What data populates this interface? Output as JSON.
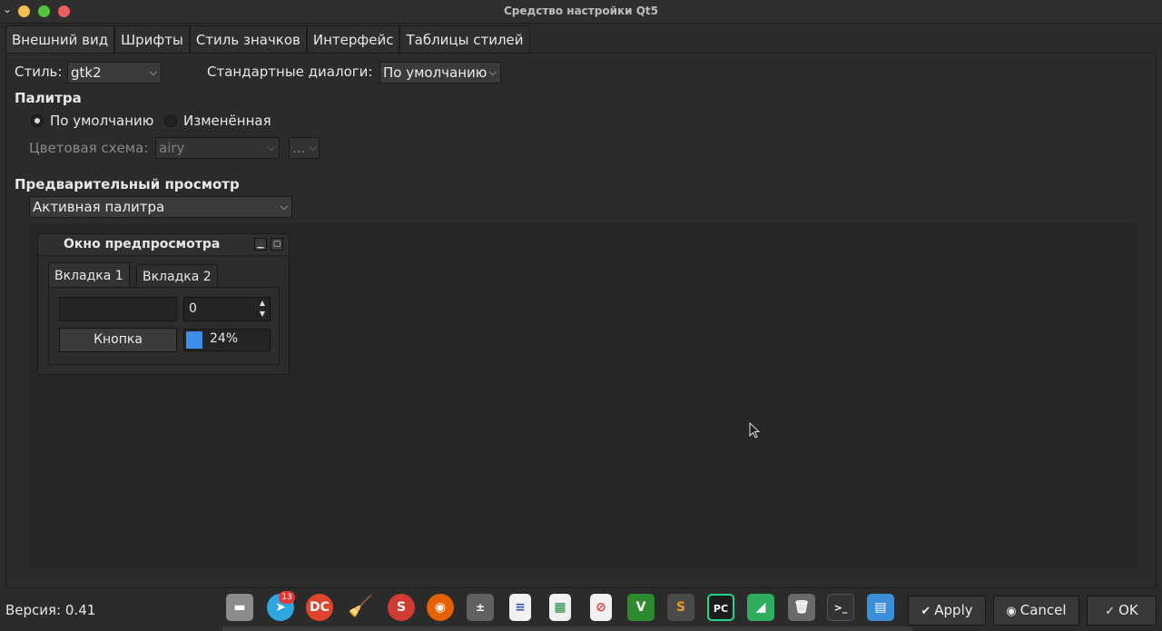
{
  "window": {
    "title": "Средство настройки Qt5"
  },
  "tabs": [
    {
      "label": "Внешний вид"
    },
    {
      "label": "Шрифты"
    },
    {
      "label": "Стиль значков"
    },
    {
      "label": "Интерфейс"
    },
    {
      "label": "Таблицы стилей"
    }
  ],
  "appearance": {
    "style_label": "Стиль:",
    "style_value": "gtk2",
    "dialogs_label": "Стандартные диалоги:",
    "dialogs_value": "По умолчанию",
    "palette_heading": "Палитра",
    "palette_default": "По умолчанию",
    "palette_custom": "Изменённая",
    "scheme_label": "Цветовая схема:",
    "scheme_value": "airy",
    "scheme_more": "...",
    "preview_heading": "Предварительный просмотр",
    "preview_combo": "Активная палитра"
  },
  "preview": {
    "window_title": "Окно предпросмотра",
    "tab1": "Вкладка 1",
    "tab2": "Вкладка 2",
    "spin_value": "0",
    "button_label": "Кнопка",
    "progress_text": "24%",
    "progress_value": 0.24
  },
  "footer": {
    "version": "Версия: 0.41",
    "apply": "Apply",
    "cancel": "Cancel",
    "ok": "OK"
  },
  "dock": {
    "telegram_badge": "13",
    "items": [
      {
        "name": "files-icon",
        "color": "#9e9e9e"
      },
      {
        "name": "telegram-icon",
        "color": "#2ea6e0"
      },
      {
        "name": "doublecmd-icon",
        "color": "#e0442c"
      },
      {
        "name": "bleachbit-icon",
        "color": "#2b2b2b"
      },
      {
        "name": "stacer-icon",
        "color": "#d23b33"
      },
      {
        "name": "firefox-icon",
        "color": "#e66000"
      },
      {
        "name": "calculator-icon",
        "color": "#6b6b6b"
      },
      {
        "name": "writer-icon",
        "color": "#f1f1f1"
      },
      {
        "name": "calc-icon",
        "color": "#f1f1f1"
      },
      {
        "name": "doc-blocked-icon",
        "color": "#f1f1f1"
      },
      {
        "name": "vim-icon",
        "color": "#2d8a2d"
      },
      {
        "name": "sublime-icon",
        "color": "#4a4a4a"
      },
      {
        "name": "pycharm-icon",
        "color": "#1d1d1d"
      },
      {
        "name": "monitor-icon",
        "color": "#2fae5f"
      },
      {
        "name": "trash-icon",
        "color": "#6a6a6a"
      },
      {
        "name": "terminal-icon",
        "color": "#333333"
      },
      {
        "name": "window-manager-icon",
        "color": "#3d8fd8"
      }
    ]
  }
}
